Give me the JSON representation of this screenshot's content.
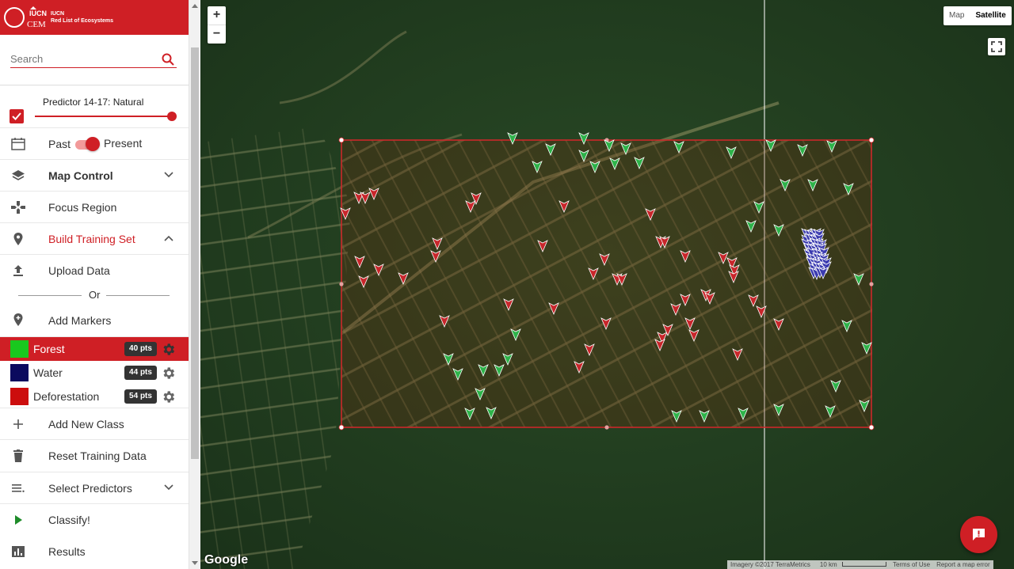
{
  "header": {
    "logo_lines": [
      "IUCN",
      "Red List of Ecosystems"
    ],
    "logo_mark_top": "IUCN",
    "logo_mark_bottom": "CEM"
  },
  "search": {
    "placeholder": "Search"
  },
  "predictor": {
    "label": "Predictor 14-17: Natural",
    "checked": true,
    "slider_value": 1.0
  },
  "time_toggle": {
    "past": "Past",
    "present": "Present",
    "selected": "Present"
  },
  "menu": {
    "map_control": "Map Control",
    "focus_region": "Focus Region",
    "build_training_set": "Build Training Set",
    "upload_data": "Upload Data",
    "or": "Or",
    "add_markers": "Add Markers",
    "add_new_class": "Add New Class",
    "reset_training_data": "Reset Training Data",
    "select_predictors": "Select Predictors",
    "classify": "Classify!",
    "results": "Results"
  },
  "classes": [
    {
      "name": "Forest",
      "points": "40 pts",
      "color": "#19c81e",
      "active": true
    },
    {
      "name": "Water",
      "points": "44 pts",
      "color": "#0b0a5e",
      "active": false
    },
    {
      "name": "Deforestation",
      "points": "54 pts",
      "color": "#cc0d0d",
      "active": false
    }
  ],
  "map": {
    "zoom_in": "+",
    "zoom_out": "−",
    "type_options": [
      "Map",
      "Satellite"
    ],
    "type_selected": "Satellite",
    "google": "Google",
    "attribution": [
      "Imagery ©2017 TerraMetrics",
      "10 km",
      "Terms of Use",
      "Report a map error"
    ]
  },
  "colors": {
    "accent": "#cf1f25",
    "forest_marker": "#2eb34a",
    "deforest_marker": "#c8262b",
    "water_marker": "#3b3bb0"
  }
}
